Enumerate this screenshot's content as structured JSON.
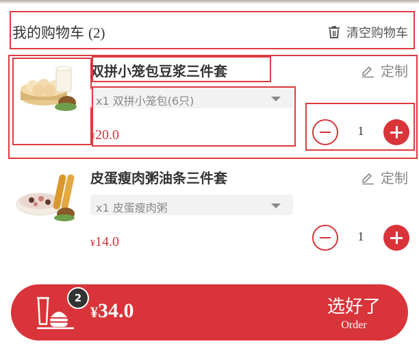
{
  "cart": {
    "title": "我的购物车",
    "count_text": "(2)",
    "clear_label": "清空购物车"
  },
  "items": [
    {
      "name": "双拼小笼包豆浆三件套",
      "custom_label": "定制",
      "option": "x1 双拼小笼包(6只)",
      "currency": "¥",
      "price": "20.0",
      "quantity": "1"
    },
    {
      "name": "皮蛋瘦肉粥油条三件套",
      "custom_label": "定制",
      "option": "x1 皮蛋瘦肉粥",
      "currency": "¥",
      "price": "14.0",
      "quantity": "1"
    }
  ],
  "checkout": {
    "badge": "2",
    "currency": "¥",
    "total": "34.0",
    "button_cn": "选好了",
    "button_en": "Order"
  },
  "icons": {
    "clear": "trash-icon",
    "custom": "edit-icon",
    "bag": "food-tray-icon",
    "minus": "minus-circle-icon",
    "plus": "plus-circle-icon",
    "dropdown": "caret-down-icon"
  },
  "colors": {
    "accent": "#d8343a",
    "highlight": "#e0393e",
    "badge": "#333333"
  }
}
